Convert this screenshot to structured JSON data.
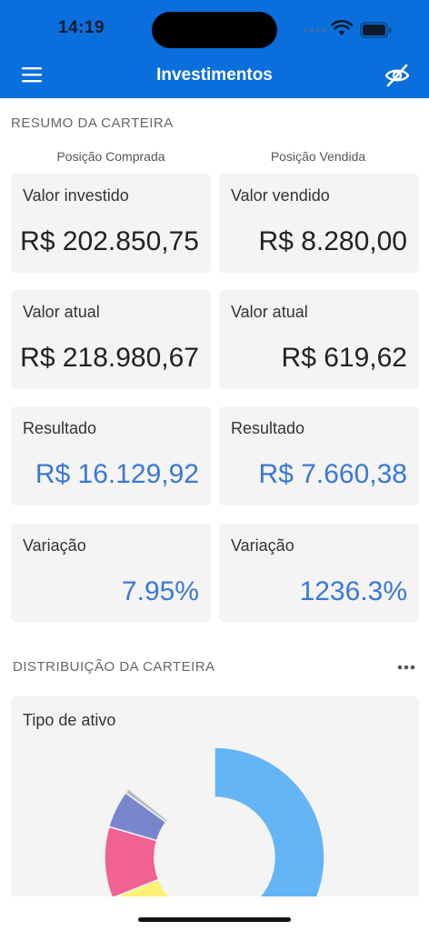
{
  "status": {
    "time": "14:19"
  },
  "header": {
    "title": "Investimentos"
  },
  "summary": {
    "title": "RESUMO DA CARTEIRA",
    "long_heading": "Posição Comprada",
    "short_heading": "Posição Vendida",
    "cards": [
      {
        "label": "Valor investido",
        "value": "R$ 202.850,75"
      },
      {
        "label": "Valor vendido",
        "value": "R$ 8.280,00"
      },
      {
        "label": "Valor atual",
        "value": "R$ 218.980,67"
      },
      {
        "label": "Valor atual",
        "value": "R$ 619,62"
      },
      {
        "label": "Resultado",
        "value": "R$ 16.129,92"
      },
      {
        "label": "Resultado",
        "value": "R$ 7.660,38"
      },
      {
        "label": "Variação",
        "value": "7.95%"
      },
      {
        "label": "Variação",
        "value": "1236.3%"
      }
    ]
  },
  "distribution": {
    "title": "DISTRIBUIÇÃO DA CARTEIRA",
    "card_label": "Tipo de ativo",
    "chart_data": {
      "type": "pie",
      "values": [
        0.5,
        0.19,
        0.105,
        0.055,
        0.007
      ],
      "colors": [
        "#64b5f6",
        "#fff176",
        "#f06292",
        "#7986cb",
        "#b0bec5"
      ]
    }
  },
  "colors": {
    "header": "#0a6fdc",
    "positive": "#3a78d6",
    "card_bg": "#f4f4f4"
  }
}
